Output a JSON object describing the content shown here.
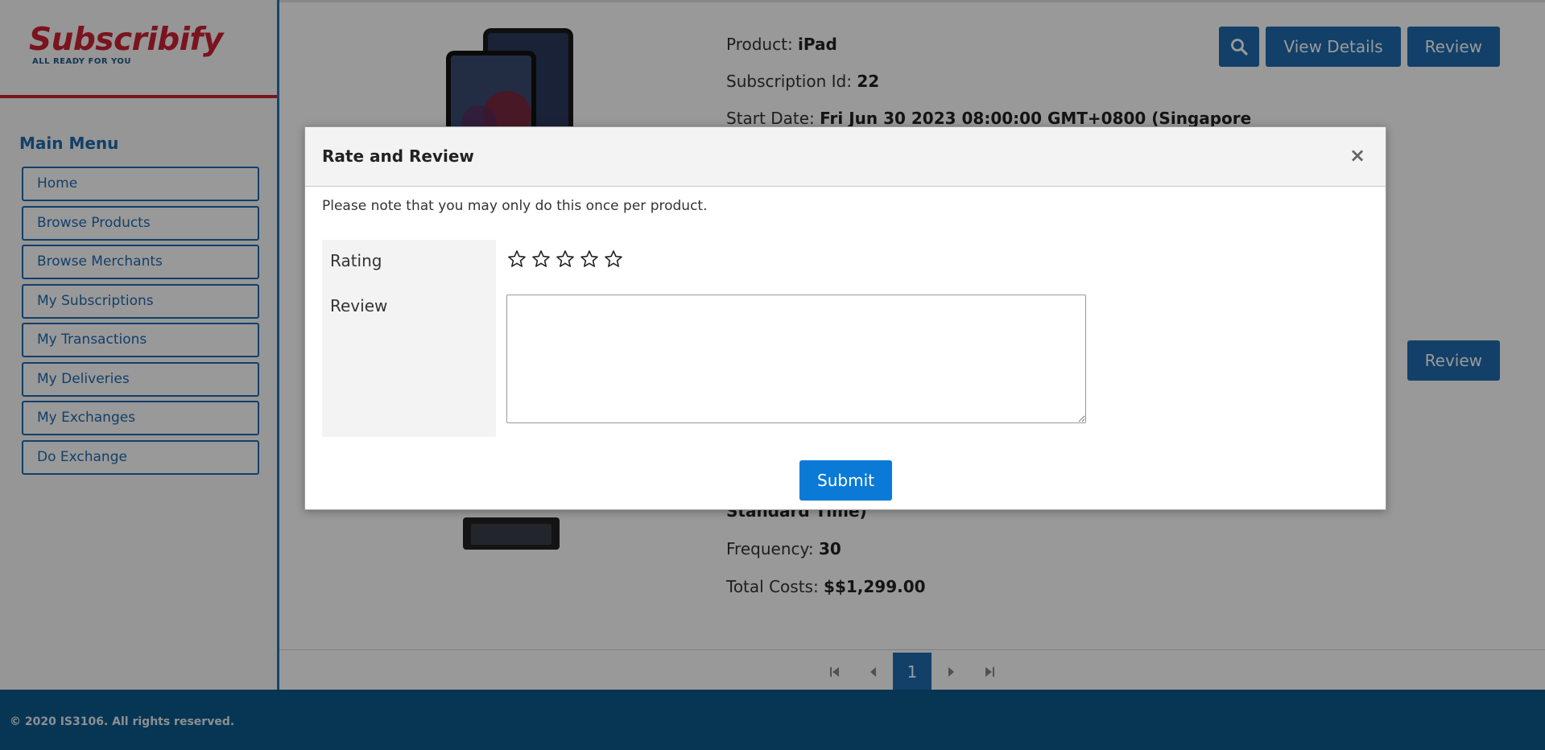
{
  "brand": {
    "name": "Subscribify",
    "tagline": "ALL READY FOR YOU",
    "color": "#cc2233"
  },
  "sidebar": {
    "title": "Main Menu",
    "items": [
      {
        "label": "Home"
      },
      {
        "label": "Browse Products"
      },
      {
        "label": "Browse Merchants"
      },
      {
        "label": "My Subscriptions"
      },
      {
        "label": "My Transactions"
      },
      {
        "label": "My Deliveries"
      },
      {
        "label": "My Exchanges"
      },
      {
        "label": "Do Exchange"
      }
    ]
  },
  "subscriptions": [
    {
      "product_label": "Product:",
      "product": "iPad",
      "id_label": "Subscription Id:",
      "id": "22",
      "start_label": "Start Date:",
      "start": "Fri Jun 30 2023 08:00:00 GMT+0800 (Singapore",
      "actions": {
        "search_icon": "search-icon",
        "details": "View Details",
        "review": "Review"
      }
    },
    {
      "start_tail": "Standard Time)",
      "frequency_label": "Frequency:",
      "frequency": "30",
      "total_label": "Total Costs:",
      "total": "$$1,299.00",
      "actions": {
        "review": "Review"
      }
    }
  ],
  "pagination": {
    "current": "1",
    "first_icon": "first-page-icon",
    "prev_icon": "prev-page-icon",
    "next_icon": "next-page-icon",
    "last_icon": "last-page-icon"
  },
  "footer": {
    "text": "© 2020 IS3106. All rights reserved."
  },
  "modal": {
    "title": "Rate and Review",
    "close": "×",
    "note": "Please note that you may only do this once per product.",
    "rating_label": "Rating",
    "review_label": "Review",
    "rating_value": 0,
    "rating_max": 5,
    "review_value": "",
    "submit": "Submit"
  },
  "colors": {
    "primary": "#1f6bb0",
    "submit": "#0a7ad6",
    "footer": "#0a5a8c"
  }
}
